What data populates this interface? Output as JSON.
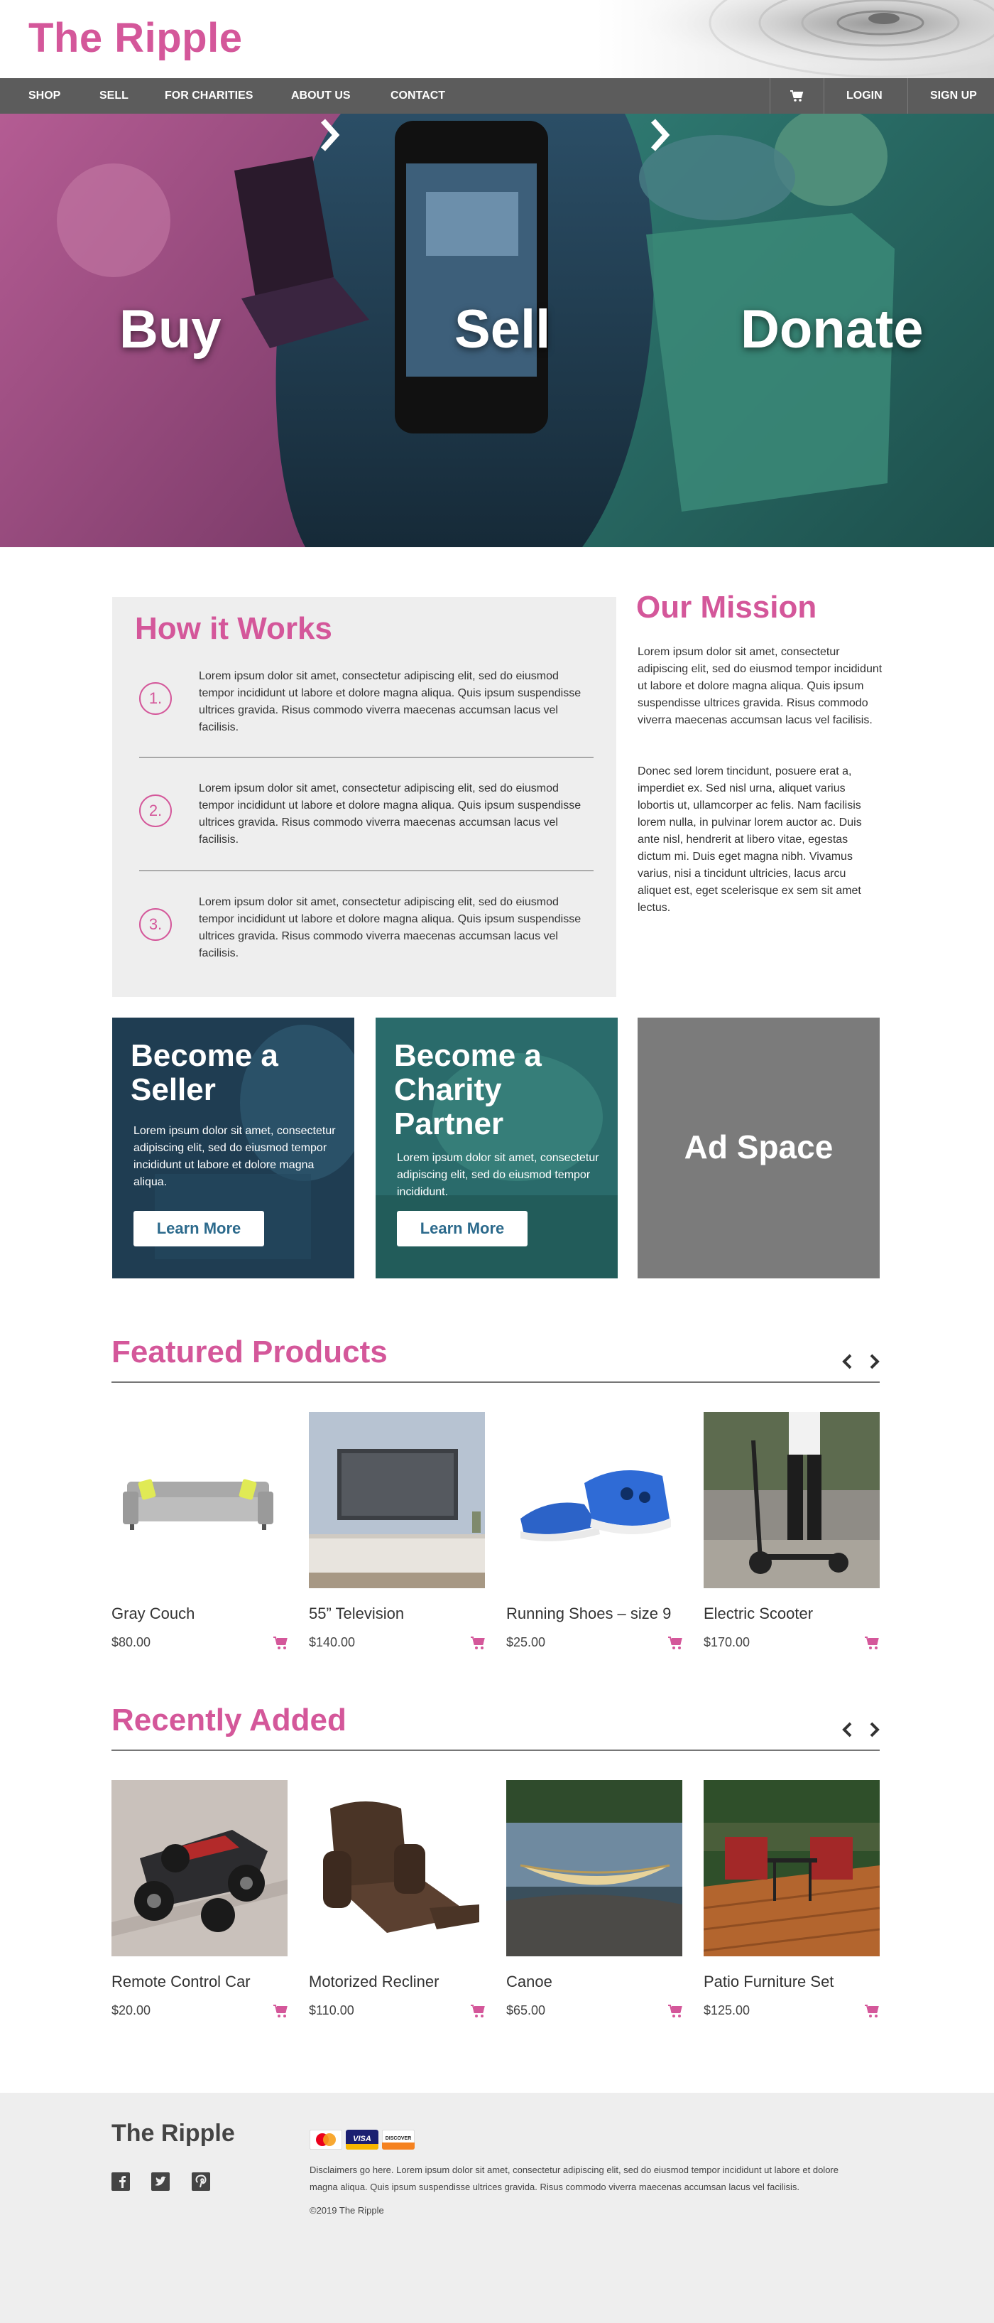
{
  "brand": "The Ripple",
  "nav": {
    "items": [
      "SHOP",
      "SELL",
      "FOR CHARITIES",
      "ABOUT US",
      "CONTACT"
    ],
    "login": "LOGIN",
    "signup": "SIGN UP"
  },
  "hero": {
    "buy": "Buy",
    "sell": "Sell",
    "donate": "Donate"
  },
  "how": {
    "title": "How it Works",
    "steps": [
      {
        "num": "1.",
        "text": "Lorem ipsum dolor sit amet, consectetur adipiscing elit, sed do eiusmod tempor incididunt ut labore et dolore magna aliqua. Quis ipsum suspendisse ultrices gravida. Risus commodo viverra maecenas accumsan lacus vel facilisis."
      },
      {
        "num": "2.",
        "text": "Lorem ipsum dolor sit amet, consectetur adipiscing elit, sed do eiusmod tempor incididunt ut labore et dolore magna aliqua. Quis ipsum suspendisse ultrices gravida. Risus commodo viverra maecenas accumsan lacus vel facilisis."
      },
      {
        "num": "3.",
        "text": "Lorem ipsum dolor sit amet, consectetur adipiscing elit, sed do eiusmod tempor incididunt ut labore et dolore magna aliqua. Quis ipsum suspendisse ultrices gravida. Risus commodo viverra maecenas accumsan lacus vel facilisis."
      }
    ]
  },
  "mission": {
    "title": "Our Mission",
    "p1": "Lorem ipsum dolor sit amet, consectetur adipiscing elit, sed do eiusmod tempor incididunt ut labore et dolore magna aliqua. Quis ipsum suspendisse ultrices gravida. Risus commodo viverra maecenas accumsan lacus vel facilisis.",
    "p2": "Donec sed lorem tincidunt, posuere erat a, imperdiet ex. Sed nisl urna, aliquet varius lobortis ut, ullamcorper ac felis. Nam facilisis lorem nulla, in pulvinar lorem auctor ac. Duis ante nisl, hendrerit at libero vitae, egestas dictum mi. Duis eget magna nibh. Vivamus varius, nisi a tincidunt ultricies, lacus arcu aliquet est, eget scelerisque ex sem sit amet lectus."
  },
  "promo": {
    "seller": {
      "title1": "Become a",
      "title2": "Seller",
      "text": "Lorem ipsum dolor sit amet, consectetur adipiscing elit, sed do eiusmod tempor incididunt ut labore et dolore magna aliqua.",
      "button": "Learn More"
    },
    "charity": {
      "title1": "Become a",
      "title2": "Charity",
      "title3": "Partner",
      "text": "Lorem ipsum dolor sit amet, consectetur adipiscing elit, sed do eiusmod tempor incididunt.",
      "button": "Learn More"
    },
    "ad": "Ad Space"
  },
  "featured": {
    "title": "Featured Products",
    "products": [
      {
        "name": "Gray Couch",
        "price": "$80.00"
      },
      {
        "name": "55” Television",
        "price": "$140.00"
      },
      {
        "name": "Running Shoes – size 9",
        "price": "$25.00"
      },
      {
        "name": "Electric Scooter",
        "price": "$170.00"
      }
    ]
  },
  "recent": {
    "title": "Recently Added",
    "products": [
      {
        "name": "Remote Control Car",
        "price": "$20.00"
      },
      {
        "name": "Motorized Recliner",
        "price": "$110.00"
      },
      {
        "name": "Canoe",
        "price": "$65.00"
      },
      {
        "name": "Patio Furniture Set",
        "price": "$125.00"
      }
    ]
  },
  "footer": {
    "brand": "The Ripple",
    "payments": [
      "MasterCard",
      "VISA",
      "DISCOVER"
    ],
    "disclaimer": "Disclaimers go here. Lorem ipsum dolor sit amet, consectetur adipiscing elit, sed do eiusmod tempor incididunt ut labore et dolore magna aliqua. Quis ipsum suspendisse ultrices gravida. Risus commodo viverra maecenas accumsan lacus vel facilisis.",
    "copyright": "©2019 The Ripple"
  },
  "colors": {
    "accent": "#d4579a",
    "nav": "#5c5c5c",
    "button_text": "#2c6a8c",
    "ad": "#7b7b7b",
    "footer": "#eeeeee"
  },
  "icons": [
    "cart-icon",
    "chevron-right-icon",
    "chevron-left-icon",
    "facebook-icon",
    "twitter-icon",
    "pinterest-icon"
  ]
}
